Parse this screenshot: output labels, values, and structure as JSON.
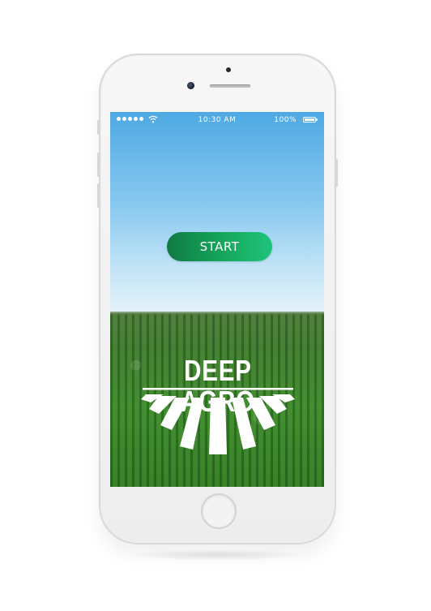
{
  "status_bar": {
    "time": "10:30 AM",
    "battery": "100%",
    "signal_icon": "signal-dots-icon",
    "wifi_icon": "wifi-icon",
    "battery_icon": "battery-icon"
  },
  "main": {
    "start_label": "START",
    "brand_name": "DEEP AGRO"
  },
  "colors": {
    "button_start": "#0f7a44",
    "button_end": "#1dc47a",
    "sky_top": "#4ea9e4",
    "field": "#3b8a2c"
  }
}
